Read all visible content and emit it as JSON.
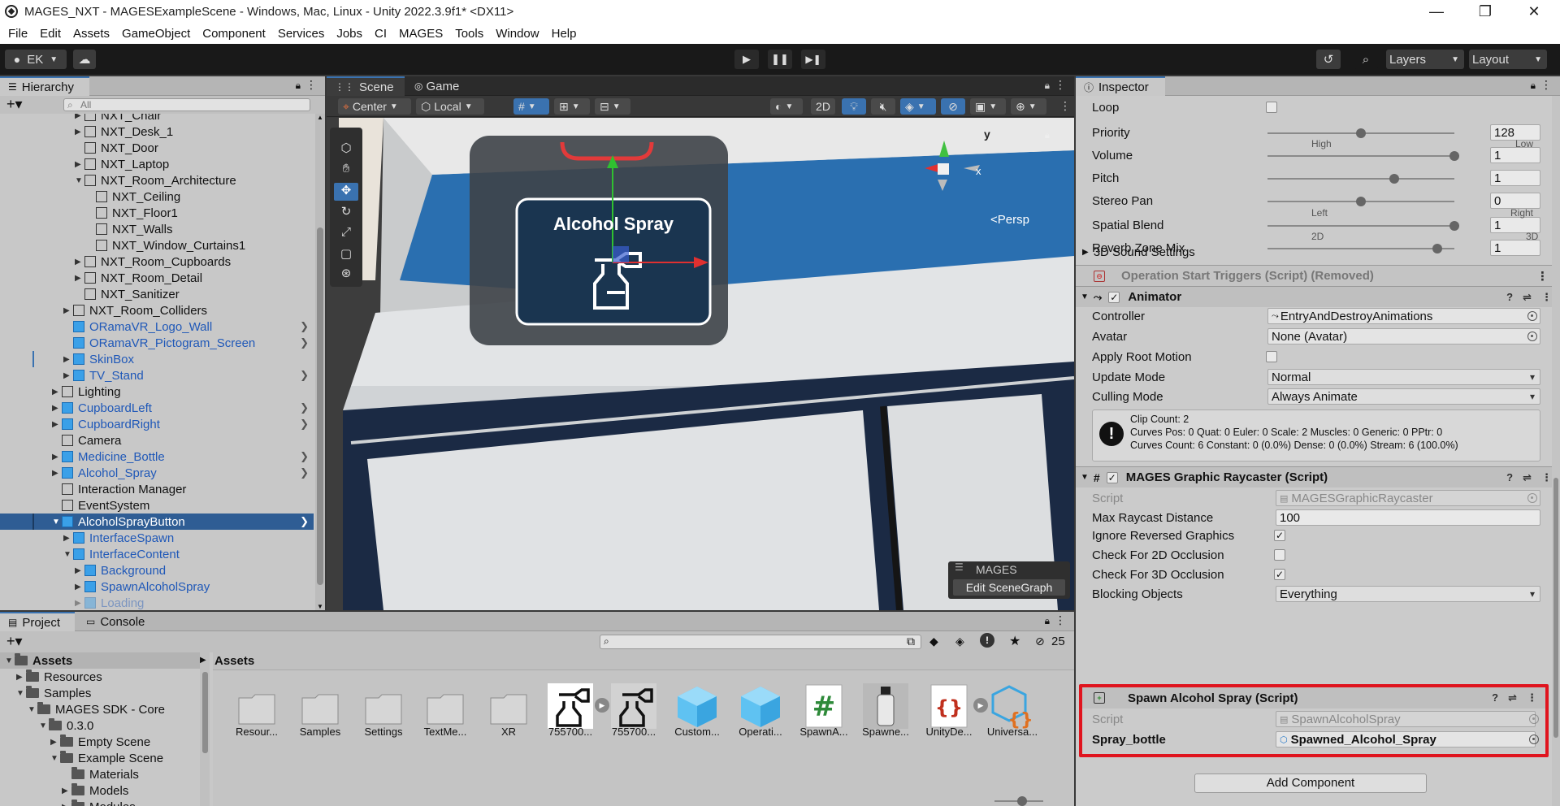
{
  "titlebar": {
    "title": "MAGES_NXT - MAGESExampleScene - Windows, Mac, Linux - Unity 2022.3.9f1* <DX11>",
    "minimize": "—",
    "restore": "❐",
    "close": "✕"
  },
  "menu": [
    "File",
    "Edit",
    "Assets",
    "GameObject",
    "Component",
    "Services",
    "Jobs",
    "CI",
    "MAGES",
    "Tools",
    "Window",
    "Help"
  ],
  "toolbar": {
    "account": "EK",
    "layers": "Layers",
    "layout": "Layout"
  },
  "hierarchy": {
    "tab": "Hierarchy",
    "search_placeholder": "All",
    "rows": [
      {
        "label": "NXT_Chair",
        "indent": 6,
        "type": "gray",
        "arrow": "right"
      },
      {
        "label": "NXT_Desk_1",
        "indent": 6,
        "type": "gray",
        "arrow": "right"
      },
      {
        "label": "NXT_Door",
        "indent": 6,
        "type": "gray",
        "arrow": ""
      },
      {
        "label": "NXT_Laptop",
        "indent": 6,
        "type": "gray",
        "arrow": "right"
      },
      {
        "label": "NXT_Room_Architecture",
        "indent": 6,
        "type": "gray",
        "arrow": "down"
      },
      {
        "label": "NXT_Ceiling",
        "indent": 7,
        "type": "gray",
        "arrow": ""
      },
      {
        "label": "NXT_Floor1",
        "indent": 7,
        "type": "gray",
        "arrow": ""
      },
      {
        "label": "NXT_Walls",
        "indent": 7,
        "type": "gray",
        "arrow": ""
      },
      {
        "label": "NXT_Window_Curtains1",
        "indent": 7,
        "type": "gray",
        "arrow": ""
      },
      {
        "label": "NXT_Room_Cupboards",
        "indent": 6,
        "type": "gray",
        "arrow": "right"
      },
      {
        "label": "NXT_Room_Detail",
        "indent": 6,
        "type": "gray",
        "arrow": "right"
      },
      {
        "label": "NXT_Sanitizer",
        "indent": 6,
        "type": "gray",
        "arrow": ""
      },
      {
        "label": "NXT_Room_Colliders",
        "indent": 5,
        "type": "gray",
        "arrow": "right"
      },
      {
        "label": "ORamaVR_Logo_Wall",
        "indent": 5,
        "type": "blue",
        "arrow": "",
        "chev": true
      },
      {
        "label": "ORamaVR_Pictogram_Screen",
        "indent": 5,
        "type": "blue",
        "arrow": "",
        "chev": true
      },
      {
        "label": "SkinBox",
        "indent": 5,
        "type": "blue",
        "arrow": "right"
      },
      {
        "label": "TV_Stand",
        "indent": 5,
        "type": "blue",
        "arrow": "right",
        "chev": true
      },
      {
        "label": "Lighting",
        "indent": 4,
        "type": "gray",
        "arrow": "right"
      },
      {
        "label": "CupboardLeft",
        "indent": 4,
        "type": "blue",
        "arrow": "right",
        "chev": true
      },
      {
        "label": "CupboardRight",
        "indent": 4,
        "type": "blue",
        "arrow": "right",
        "chev": true
      },
      {
        "label": "Camera",
        "indent": 4,
        "type": "gray",
        "arrow": ""
      },
      {
        "label": "Medicine_Bottle",
        "indent": 4,
        "type": "blue",
        "arrow": "right",
        "chev": true
      },
      {
        "label": "Alcohol_Spray",
        "indent": 4,
        "type": "blue",
        "arrow": "right",
        "chev": true
      },
      {
        "label": "Interaction Manager",
        "indent": 4,
        "type": "gray",
        "arrow": ""
      },
      {
        "label": "EventSystem",
        "indent": 4,
        "type": "gray",
        "arrow": ""
      },
      {
        "label": "AlcoholSprayButton",
        "indent": 4,
        "type": "blue",
        "arrow": "down",
        "chev": true,
        "selected": true
      },
      {
        "label": "InterfaceSpawn",
        "indent": 5,
        "type": "blue",
        "arrow": "right"
      },
      {
        "label": "InterfaceContent",
        "indent": 5,
        "type": "blue",
        "arrow": "down"
      },
      {
        "label": "Background",
        "indent": 6,
        "type": "blue",
        "arrow": "right"
      },
      {
        "label": "SpawnAlcoholSpray",
        "indent": 6,
        "type": "blue",
        "arrow": "right"
      },
      {
        "label": "Loading",
        "indent": 6,
        "type": "blue",
        "arrow": "right",
        "faded": true
      }
    ]
  },
  "scene": {
    "tabs": [
      "Scene",
      "Game"
    ],
    "pivot": "Center",
    "space": "Local",
    "mode_2d": "2D",
    "persp": "<Persp",
    "gizmo_y": "y",
    "gizmo_x": "x",
    "card_title": "Alcohol Spray",
    "mages_label": "MAGES",
    "edit_scenegraph": "Edit SceneGraph"
  },
  "inspector": {
    "tab": "Inspector",
    "audio": [
      {
        "label": "Loop"
      },
      {
        "label": "Priority",
        "value": "128",
        "knob": 0.5
      },
      {
        "label": "Volume",
        "value": "1",
        "knob": 1.0
      },
      {
        "label": "Pitch",
        "value": "1",
        "knob": 0.68
      },
      {
        "label": "Stereo Pan",
        "value": "0",
        "knob": 0.5
      },
      {
        "label": "Spatial Blend",
        "value": "1",
        "knob": 1.0
      },
      {
        "label": "Reverb Zone Mix",
        "value": "1",
        "knob": 0.91
      }
    ],
    "priority_low": "Low",
    "priority_high": "High",
    "pan_left": "Left",
    "pan_right": "Right",
    "blend_2d": "2D",
    "blend_3d": "3D",
    "sound3d": "3D Sound Settings",
    "op_triggers": "Operation Start Triggers (Script) (Removed)",
    "animator": {
      "title": "Animator",
      "controller_label": "Controller",
      "controller_value": "EntryAndDestroyAnimations",
      "avatar_label": "Avatar",
      "avatar_value": "None (Avatar)",
      "root_motion_label": "Apply Root Motion",
      "update_mode_label": "Update Mode",
      "update_mode_value": "Normal",
      "culling_mode_label": "Culling Mode",
      "culling_mode_value": "Always Animate",
      "info_line1": "Clip Count: 2",
      "info_line2": "Curves Pos: 0 Quat: 0 Euler: 0 Scale: 2 Muscles: 0 Generic: 0 PPtr: 0",
      "info_line3": "Curves Count: 6 Constant: 0 (0.0%) Dense: 0 (0.0%) Stream: 6 (100.0%)"
    },
    "raycaster": {
      "title": "MAGES Graphic Raycaster (Script)",
      "script_label": "Script",
      "script_value": "MAGESGraphicRaycaster",
      "max_dist_label": "Max Raycast Distance",
      "max_dist_value": "100",
      "ignore_label": "Ignore Reversed Graphics",
      "check2d_label": "Check For 2D Occlusion",
      "check3d_label": "Check For 3D Occlusion",
      "blocking_label": "Blocking Objects",
      "blocking_value": "Everything"
    },
    "spawn": {
      "title": "Spawn Alcohol Spray (Script)",
      "script_label": "Script",
      "script_value": "SpawnAlcoholSpray",
      "bottle_label": "Spray_bottle",
      "bottle_value": "Spawned_Alcohol_Spray"
    },
    "add_component": "Add Component",
    "check": "✓"
  },
  "project": {
    "tabs": [
      "Project",
      "Console"
    ],
    "search_count": "25",
    "breadcrumb": "Assets",
    "tree": [
      {
        "label": "Assets",
        "indent": 0,
        "arrow": "down",
        "selected": true
      },
      {
        "label": "Resources",
        "indent": 1,
        "arrow": "right"
      },
      {
        "label": "Samples",
        "indent": 1,
        "arrow": "down"
      },
      {
        "label": "MAGES SDK - Core",
        "indent": 2,
        "arrow": "down"
      },
      {
        "label": "0.3.0",
        "indent": 3,
        "arrow": "down"
      },
      {
        "label": "Empty Scene",
        "indent": 4,
        "arrow": "right"
      },
      {
        "label": "Example Scene",
        "indent": 4,
        "arrow": "down"
      },
      {
        "label": "Materials",
        "indent": 5,
        "arrow": ""
      },
      {
        "label": "Models",
        "indent": 5,
        "arrow": "right"
      },
      {
        "label": "Modules",
        "indent": 5,
        "arrow": "right"
      }
    ],
    "assets": [
      {
        "label": "Resour...",
        "kind": "folder"
      },
      {
        "label": "Samples",
        "kind": "folder"
      },
      {
        "label": "Settings",
        "kind": "folder"
      },
      {
        "label": "TextMe...",
        "kind": "folder"
      },
      {
        "label": "XR",
        "kind": "folder"
      },
      {
        "label": "755700...",
        "kind": "spray"
      },
      {
        "label": "755700...",
        "kind": "spray2"
      },
      {
        "label": "Custom...",
        "kind": "cube"
      },
      {
        "label": "Operati...",
        "kind": "cube"
      },
      {
        "label": "SpawnA...",
        "kind": "script"
      },
      {
        "label": "Spawne...",
        "kind": "bottle"
      },
      {
        "label": "UnityDe...",
        "kind": "json"
      },
      {
        "label": "Universa...",
        "kind": "urp"
      }
    ]
  }
}
